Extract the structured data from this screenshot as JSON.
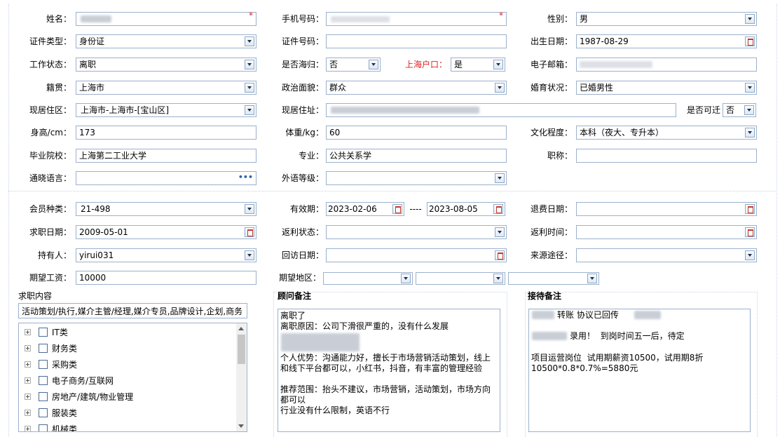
{
  "personal": {
    "name_label": "姓名：",
    "phone_label": "手机号码：",
    "gender_label": "性别：",
    "gender_value": "男",
    "id_type_label": "证件类型：",
    "id_type_value": "身份证",
    "id_number_label": "证件号码：",
    "birth_label": "出生日期：",
    "birth_value": "1987-08-29",
    "work_status_label": "工作状态：",
    "work_status_value": "离职",
    "returnee_label": "是否海归：",
    "returnee_value": "否",
    "hukou_label": "上海户口：",
    "hukou_value": "是",
    "email_label": "电子邮箱：",
    "native_label": "籍贯：",
    "native_value": "上海市",
    "political_label": "政治面貌：",
    "political_value": "群众",
    "marital_label": "婚育状况：",
    "marital_value": "已婚男性",
    "area_label": "现居住区：",
    "area_value": "上海市-上海市-[宝山区]",
    "address_label": "现居住址：",
    "relocate_label": "是否可迁",
    "relocate_value": "否",
    "height_label": "身高/cm：",
    "height_value": "173",
    "weight_label": "体重/kg：",
    "weight_value": "60",
    "education_label": "文化程度：",
    "education_value": "本科（夜大、专升本）",
    "school_label": "毕业院校：",
    "school_value": "上海第二工业大学",
    "major_label": "专业：",
    "major_value": "公共关系学",
    "title_label": "职称：",
    "language_label": "通晓语言：",
    "language_btn": "•••",
    "foreign_label": "外语等级："
  },
  "membership": {
    "type_label": "会员种类：",
    "type_value": "21-498",
    "valid_label": "有效期：",
    "valid_from": "2023-02-06",
    "valid_sep": "----",
    "valid_to": "2023-08-05",
    "refund_date_label": "退费日期：",
    "apply_date_label": "求职日期：",
    "apply_date_value": "2009-05-01",
    "rebate_status_label": "返利状态：",
    "rebate_time_label": "返利时间：",
    "holder_label": "持有人：",
    "holder_value": "yirui031",
    "visit_date_label": "回访日期：",
    "source_label": "来源途径：",
    "salary_label": "期望工资：",
    "salary_value": "10000",
    "region_label": "期望地区："
  },
  "job": {
    "title": "求职内容",
    "summary": "活动策划/执行,媒介主管/经理,媒介专员,品牌设计,企划,商务",
    "tree": [
      "IT类",
      "财务类",
      "采购类",
      "电子商务/互联网",
      "房地产/建筑/物业管理",
      "服装类",
      "机械类"
    ]
  },
  "consultant": {
    "title": "顾问备注",
    "line1": "离职了",
    "line2": "离职原因：公司下滑很严重的，没有什么发展",
    "line3": "个人优势：沟通能力好，擅长于市场营销活动策划，线上和线下平台都可以，小红书，抖音，有丰富的管理经验",
    "line4": "推荐范围：抬头不建议，市场营销，活动策划，市场方向都可以",
    "line5": "行业没有什么限制，英语不行"
  },
  "reception": {
    "title": "接待备注",
    "line1": "转账 协议已回传",
    "line2": "录用！  到岗时间五一后，待定",
    "line3": "项目运营岗位  试用期薪资10500，试用期8折",
    "line4": "10500*0.8*0.7%=5880元"
  }
}
